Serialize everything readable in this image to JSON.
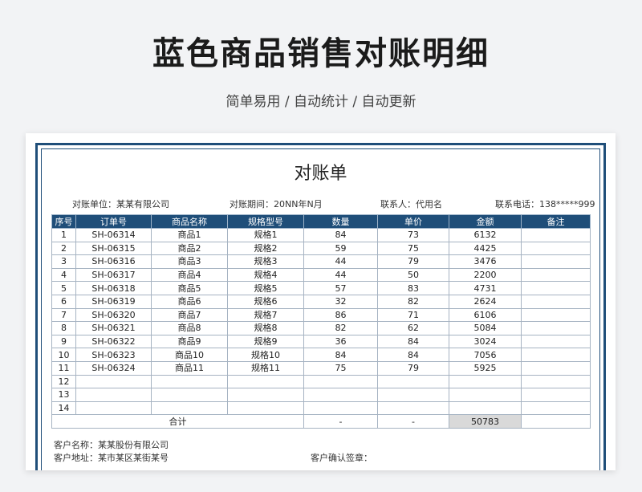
{
  "header": {
    "title": "蓝色商品销售对账明细",
    "subtitle": "简单易用 / 自动统计 / 自动更新"
  },
  "document": {
    "title": "对账单",
    "info": {
      "unit_label": "对账单位：某某有限公司",
      "period_label": "对账期间：20NN年N月",
      "contact_label": "联系人：代用名",
      "phone_label": "联系电话：138*****999"
    },
    "columns": [
      "序号",
      "订单号",
      "商品名称",
      "规格型号",
      "数量",
      "单价",
      "金额",
      "备注"
    ],
    "rows": [
      [
        "1",
        "SH-06314",
        "商品1",
        "规格1",
        "84",
        "73",
        "6132",
        ""
      ],
      [
        "2",
        "SH-06315",
        "商品2",
        "规格2",
        "59",
        "75",
        "4425",
        ""
      ],
      [
        "3",
        "SH-06316",
        "商品3",
        "规格3",
        "44",
        "79",
        "3476",
        ""
      ],
      [
        "4",
        "SH-06317",
        "商品4",
        "规格4",
        "44",
        "50",
        "2200",
        ""
      ],
      [
        "5",
        "SH-06318",
        "商品5",
        "规格5",
        "57",
        "83",
        "4731",
        ""
      ],
      [
        "6",
        "SH-06319",
        "商品6",
        "规格6",
        "32",
        "82",
        "2624",
        ""
      ],
      [
        "7",
        "SH-06320",
        "商品7",
        "规格7",
        "86",
        "71",
        "6106",
        ""
      ],
      [
        "8",
        "SH-06321",
        "商品8",
        "规格8",
        "82",
        "62",
        "5084",
        ""
      ],
      [
        "9",
        "SH-06322",
        "商品9",
        "规格9",
        "36",
        "84",
        "3024",
        ""
      ],
      [
        "10",
        "SH-06323",
        "商品10",
        "规格10",
        "84",
        "84",
        "7056",
        ""
      ],
      [
        "11",
        "SH-06324",
        "商品11",
        "规格11",
        "75",
        "79",
        "5925",
        ""
      ],
      [
        "12",
        "",
        "",
        "",
        "",
        "",
        "",
        ""
      ],
      [
        "13",
        "",
        "",
        "",
        "",
        "",
        "",
        ""
      ],
      [
        "14",
        "",
        "",
        "",
        "",
        "",
        "",
        ""
      ]
    ],
    "total": {
      "label": "合计",
      "quantity": "-",
      "price": "-",
      "amount": "50783"
    },
    "footer": {
      "customer_name": "客户名称：某某股份有限公司",
      "customer_address": "客户地址：某市某区某街某号",
      "customer_confirm": "客户确认签章："
    },
    "colors": {
      "accent": "#1f4e79",
      "total_cell_bg": "#d9d9d9"
    }
  }
}
